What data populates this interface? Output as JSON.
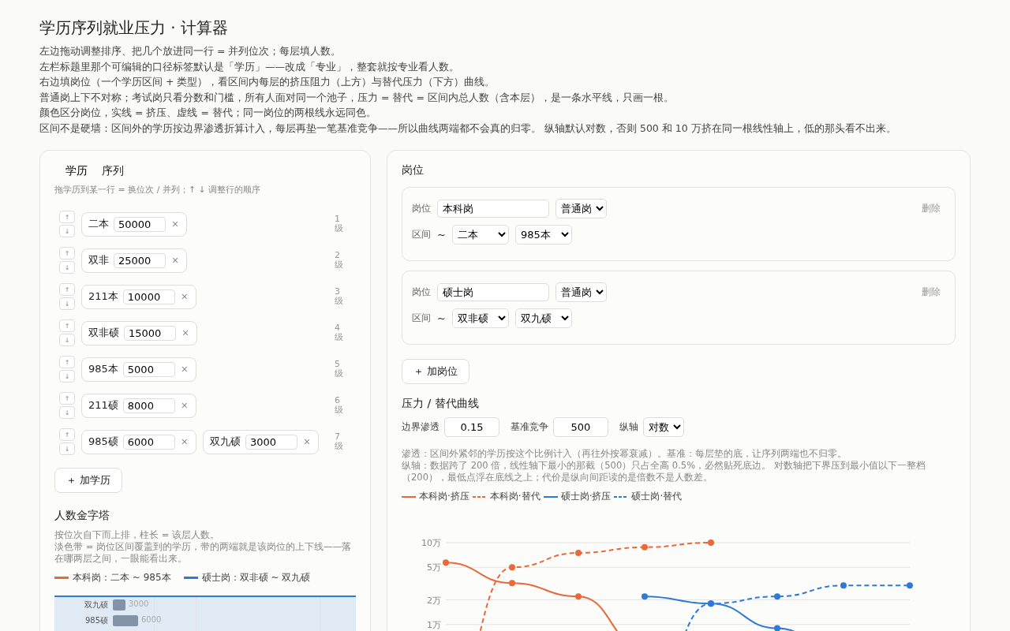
{
  "title": "学历序列就业压力 · 计算器",
  "intro": [
    "左边拖动调整排序、把几个放进同一行 = 并列位次；每层填人数。",
    "左栏标题里那个可编辑的口径标签默认是「学历」——改成「专业」，整套就按专业看人数。",
    "右边填岗位（一个学历区间 + 类型），看区间内每层的挤压阻力（上方）与替代压力（下方）曲线。",
    "普通岗上下不对称；考试岗只看分数和门槛，所有人面对同一个池子，压力 = 替代 = 区间内总人数（含本层），是一条水平线，只画一根。",
    "颜色区分岗位，实线 = 挤压、虚线 = 替代；同一岗位的两根线永远同色。",
    "区间不是硬墙：区间外的学历按边界渗透折算计入，每层再垫一笔基准竞争——所以曲线两端都不会真的归零。 纵轴默认对数，否则 500 和 10 万挤在同一根线性轴上，低的那头看不出来。"
  ],
  "sequence": {
    "dimension": "学历",
    "title": "序列",
    "hint": "拖学历到某一行 = 换位次 / 并列；↑ ↓ 调整行的顺序",
    "rows": [
      {
        "rank": "1级",
        "up": "↑",
        "down": "↓",
        "items": [
          {
            "name": "二本",
            "count": "50000",
            "remove": "×"
          }
        ]
      },
      {
        "rank": "2级",
        "up": "↑",
        "down": "↓",
        "items": [
          {
            "name": "双非",
            "count": "25000",
            "remove": "×"
          }
        ]
      },
      {
        "rank": "3级",
        "up": "↑",
        "down": "↓",
        "items": [
          {
            "name": "211本",
            "count": "10000",
            "remove": "×"
          }
        ]
      },
      {
        "rank": "4级",
        "up": "↑",
        "down": "↓",
        "items": [
          {
            "name": "双非硕",
            "count": "15000",
            "remove": "×"
          }
        ]
      },
      {
        "rank": "5级",
        "up": "↑",
        "down": "↓",
        "items": [
          {
            "name": "985本",
            "count": "5000",
            "remove": "×"
          }
        ]
      },
      {
        "rank": "6级",
        "up": "↑",
        "down": "↓",
        "items": [
          {
            "name": "211硕",
            "count": "8000",
            "remove": "×"
          }
        ]
      },
      {
        "rank": "7级",
        "up": "↑",
        "down": "↓",
        "items": [
          {
            "name": "985硕",
            "count": "6000",
            "remove": "×"
          },
          {
            "name": "双九硕",
            "count": "3000",
            "remove": "×"
          }
        ]
      }
    ],
    "add": "＋ 加学历"
  },
  "pyramid": {
    "title": "人数金字塔",
    "notes": [
      "按位次自下而上排，柱长 = 该层人数。",
      "淡色带 = 岗位区间覆盖到的学历，带的两端就是该岗位的上下线——落在哪两层之间，一眼能看出来。"
    ],
    "legend": [
      {
        "label": "本科岗：二本 ~ 985本",
        "color": "#e8693a"
      },
      {
        "label": "硕士岗：双非硕 ~ 双九硕",
        "color": "#2f7ad6"
      }
    ],
    "bars": [
      {
        "label": "双九硕",
        "value": "3000"
      },
      {
        "label": "985硕",
        "value": "6000"
      }
    ]
  },
  "posts": {
    "title": "岗位",
    "items": [
      {
        "name_label": "岗位",
        "name": "本科岗",
        "type": "普通岗",
        "delete": "删除",
        "range_label": "区间",
        "tilde": "~",
        "from": "二本",
        "to": "985本"
      },
      {
        "name_label": "岗位",
        "name": "硕士岗",
        "type": "普通岗",
        "delete": "删除",
        "range_label": "区间",
        "tilde": "~",
        "from": "双非硕",
        "to": "双九硕"
      }
    ],
    "add": "＋ 加岗位"
  },
  "curves": {
    "title": "压力 / 替代曲线",
    "controls": [
      {
        "label": "边界渗透",
        "kind": "input",
        "value": "0.15"
      },
      {
        "label": "基准竞争",
        "kind": "input",
        "value": "500"
      },
      {
        "label": "纵轴",
        "kind": "select",
        "value": "对数"
      }
    ],
    "notes": [
      "渗透：区间外紧邻的学历按这个比例计入（再往外按幂衰减）。基准：每层垫的底，让序列两端也不归零。",
      "纵轴：数据跨了 200 倍，线性轴下最小的那截（500）只占全高 0.5%，必然贴死底边。 对数轴把下界压到最小值以下一整档（200），最低点浮在底线之上；代价是纵向间距读的是倍数不是人数差。"
    ],
    "legend": [
      {
        "name": "本科岗·挤压",
        "color": "#e8693a"
      },
      {
        "name": "本科岗·替代",
        "color": "#e8693a"
      },
      {
        "name": "硕士岗·挤压",
        "color": "#2f7ad6"
      },
      {
        "name": "硕士岗·替代",
        "color": "#2f7ad6"
      }
    ],
    "axis_labels": [
      "10万",
      "5万",
      "2万",
      "1万"
    ]
  }
}
